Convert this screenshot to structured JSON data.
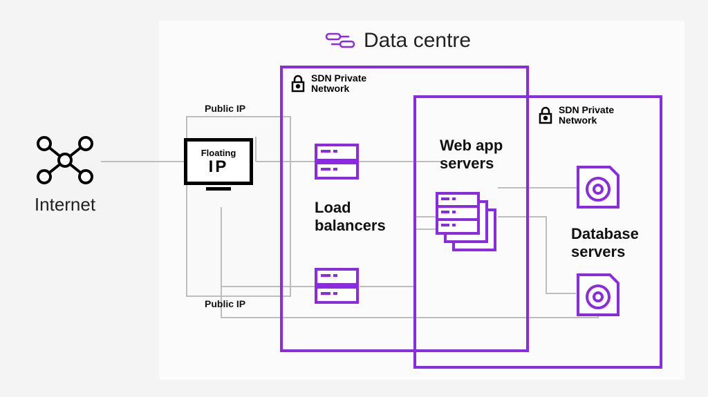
{
  "title": "Data centre",
  "internet": {
    "label": "Internet"
  },
  "floating_ip": {
    "line1": "Floating",
    "line2": "IP"
  },
  "public_ip_top": "Public IP",
  "public_ip_bottom": "Public IP",
  "sdn_left": {
    "l1": "SDN Private",
    "l2": "Network"
  },
  "sdn_right": {
    "l1": "SDN Private",
    "l2": "Network"
  },
  "load_balancers": "Load balancers",
  "web_app_servers": "Web app servers",
  "database_servers": "Database servers",
  "colors": {
    "purple": "#8a2be2",
    "gray": "#bdbdbd"
  }
}
